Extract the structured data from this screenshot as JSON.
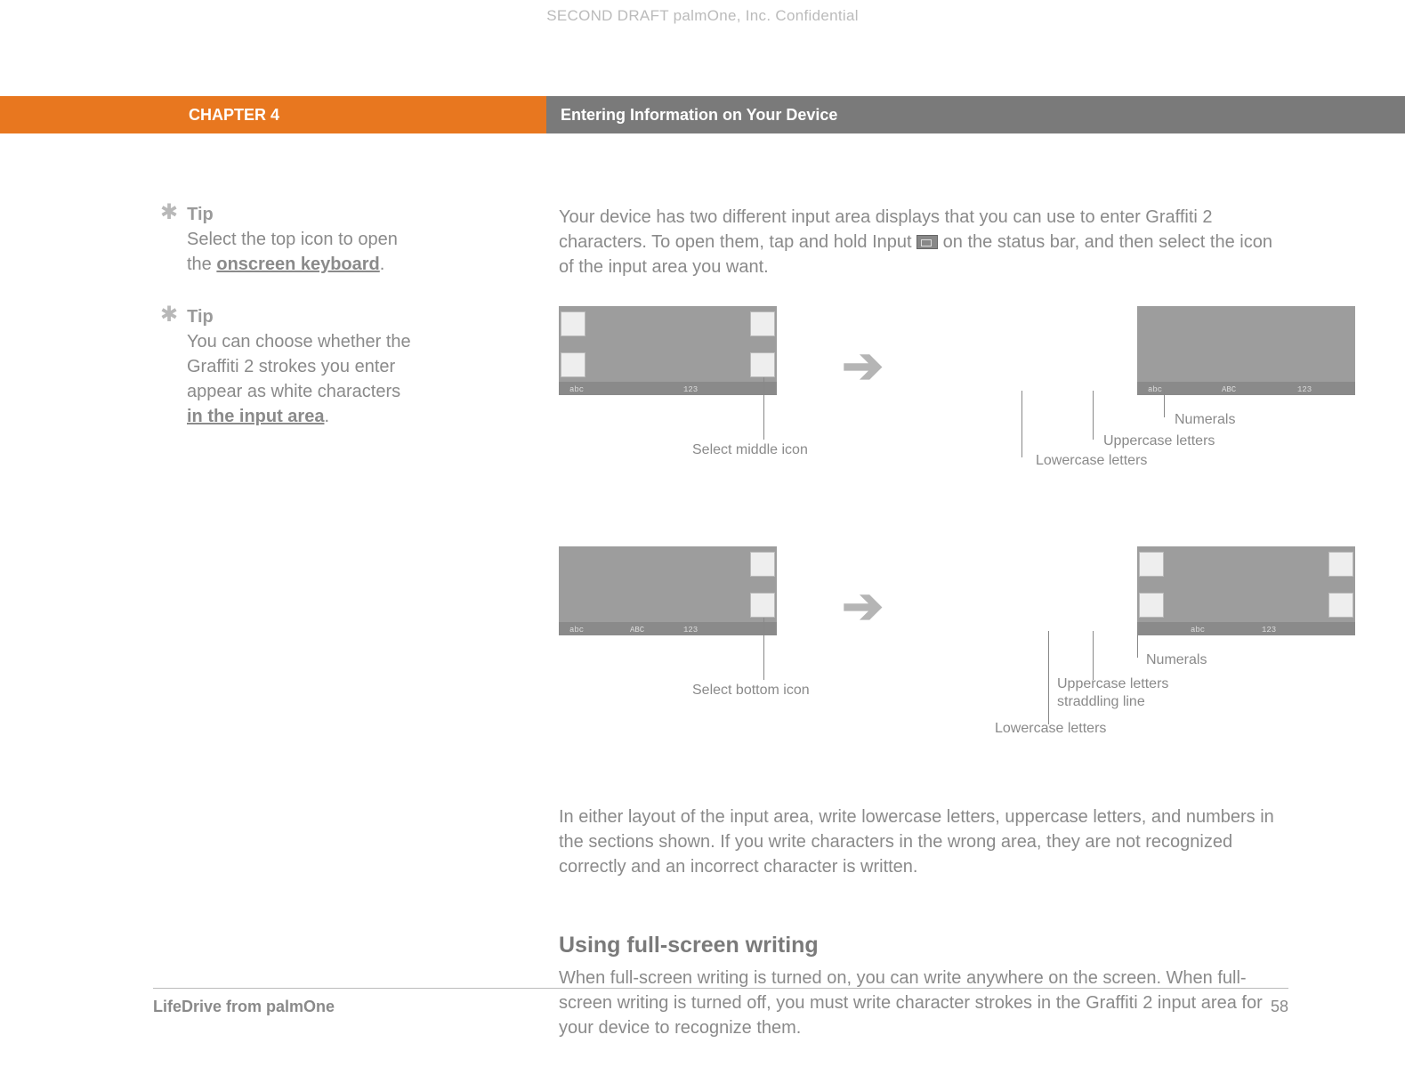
{
  "watermark": "SECOND DRAFT palmOne, Inc.  Confidential",
  "banner": {
    "chapter": "CHAPTER 4",
    "title": "Entering Information on Your Device"
  },
  "sidebar": {
    "tips": [
      {
        "heading": "Tip",
        "pre": "Select the top icon to open the ",
        "link": "onscreen keyboard",
        "post": "."
      },
      {
        "heading": "Tip",
        "pre": "You can choose whether the Graffiti 2 strokes you enter appear as white characters ",
        "link": "in the input area",
        "post": "."
      }
    ]
  },
  "main": {
    "intro_pre": "Your device has two different input area displays that you can use to enter Graffiti 2 characters. To open them, tap and hold Input ",
    "intro_post": " on the status bar, and then select the icon of the input area you want.",
    "diagram1": {
      "left_caption": "Select middle icon",
      "labels": {
        "lower": "Lowercase letters",
        "upper": "Uppercase letters",
        "num": "Numerals"
      },
      "bar_labels": [
        "abc",
        "ABC",
        "123"
      ]
    },
    "diagram2": {
      "left_caption": "Select bottom icon",
      "labels": {
        "lower": "Lowercase letters",
        "upper": "Uppercase letters straddling line",
        "num": "Numerals"
      },
      "bar_labels": [
        "abc",
        "123"
      ]
    },
    "middle_para": "In either layout of the input area, write lowercase letters, uppercase letters, and numbers in the sections shown. If you write characters in the wrong area, they are not recognized correctly and an incorrect character is written.",
    "heading2": "Using full-screen writing",
    "para2": "When full-screen writing is turned on, you can write anywhere on the screen. When full-screen writing is turned off, you must write character strokes in the Graffiti 2 input area for your device to recognize them."
  },
  "footer": {
    "title": "LifeDrive from palmOne",
    "page": "58"
  }
}
